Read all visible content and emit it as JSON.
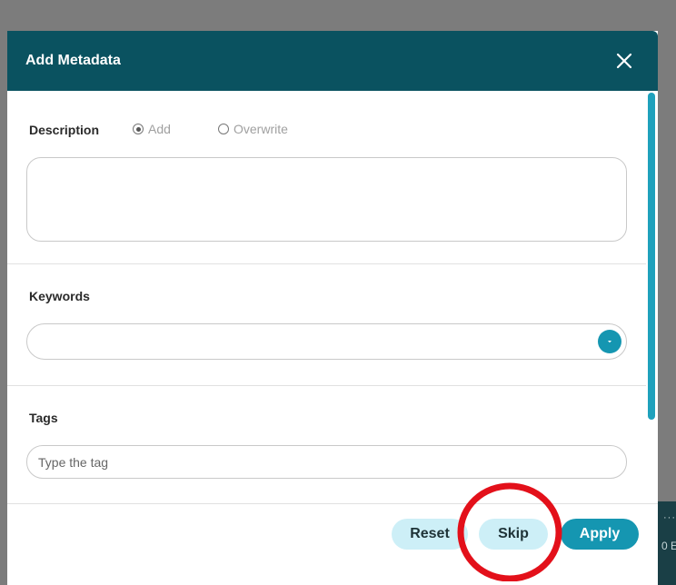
{
  "modal": {
    "title": "Add Metadata",
    "close_icon": "close-icon"
  },
  "description": {
    "label": "Description",
    "options": [
      {
        "label": "Add",
        "selected": true
      },
      {
        "label": "Overwrite",
        "selected": false
      }
    ],
    "value": ""
  },
  "keywords": {
    "label": "Keywords",
    "value": "",
    "dropdown_icon": "chevron-down-icon"
  },
  "tags": {
    "label": "Tags",
    "placeholder": "Type the tag",
    "value": ""
  },
  "footer": {
    "reset_label": "Reset",
    "skip_label": "Skip",
    "apply_label": "Apply"
  },
  "background": {
    "partial_text": "0 E"
  },
  "colors": {
    "header": "#0a5260",
    "accent": "#1596b1",
    "secondary_button": "#cdeff7",
    "annotation": "#e3101a"
  }
}
